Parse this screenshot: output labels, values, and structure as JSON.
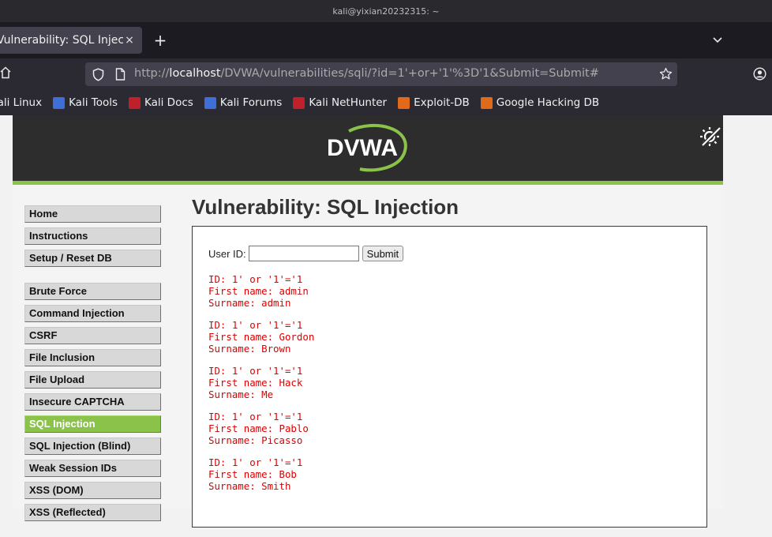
{
  "window": {
    "title": "kali@yixian20232315: ~"
  },
  "tabs": [
    {
      "title": "Vulnerability: SQL Injectio",
      "close": "×"
    }
  ],
  "tabstrip": {
    "new_tab": "+"
  },
  "navbar": {
    "url_scheme": "http://",
    "url_host": "localhost",
    "url_path": "/DVWA/vulnerabilities/sqli/?id=1'+or+'1'%3D'1&Submit=Submit#"
  },
  "bookmarks": [
    {
      "label": "Kali Linux",
      "icon": "kali-icon",
      "color": "#3d6fd6"
    },
    {
      "label": "Kali Tools",
      "icon": "kali-tools-icon",
      "color": "#3d6fd6"
    },
    {
      "label": "Kali Docs",
      "icon": "kali-docs-icon",
      "color": "#c0202a"
    },
    {
      "label": "Kali Forums",
      "icon": "kali-forums-icon",
      "color": "#3d6fd6"
    },
    {
      "label": "Kali NetHunter",
      "icon": "nethunter-icon",
      "color": "#c0202a"
    },
    {
      "label": "Exploit-DB",
      "icon": "exploit-db-icon",
      "color": "#e06a1a"
    },
    {
      "label": "Google Hacking DB",
      "icon": "ghdb-icon",
      "color": "#e06a1a"
    }
  ],
  "dvwa": {
    "logo_text": "DVWA",
    "accent": "#8bc34a",
    "menu_top": [
      {
        "label": "Home"
      },
      {
        "label": "Instructions"
      },
      {
        "label": "Setup / Reset DB"
      }
    ],
    "menu_vulns": [
      {
        "label": "Brute Force",
        "selected": false
      },
      {
        "label": "Command Injection",
        "selected": false
      },
      {
        "label": "CSRF",
        "selected": false
      },
      {
        "label": "File Inclusion",
        "selected": false
      },
      {
        "label": "File Upload",
        "selected": false
      },
      {
        "label": "Insecure CAPTCHA",
        "selected": false
      },
      {
        "label": "SQL Injection",
        "selected": true
      },
      {
        "label": "SQL Injection (Blind)",
        "selected": false
      },
      {
        "label": "Weak Session IDs",
        "selected": false
      },
      {
        "label": "XSS (DOM)",
        "selected": false
      },
      {
        "label": "XSS (Reflected)",
        "selected": false
      }
    ],
    "page_title": "Vulnerability: SQL Injection",
    "form": {
      "user_id_label": "User ID:",
      "user_id_value": "",
      "submit_label": "Submit"
    },
    "results": [
      {
        "id": "ID: 1' or '1'='1",
        "first": "First name: admin",
        "surname": "Surname: admin"
      },
      {
        "id": "ID: 1' or '1'='1",
        "first": "First name: Gordon",
        "surname": "Surname: Brown"
      },
      {
        "id": "ID: 1' or '1'='1",
        "first": "First name: Hack",
        "surname": "Surname: Me"
      },
      {
        "id": "ID: 1' or '1'='1",
        "first": "First name: Pablo",
        "surname": "Surname: Picasso"
      },
      {
        "id": "ID: 1' or '1'='1",
        "first": "First name: Bob",
        "surname": "Surname: Smith"
      }
    ]
  }
}
